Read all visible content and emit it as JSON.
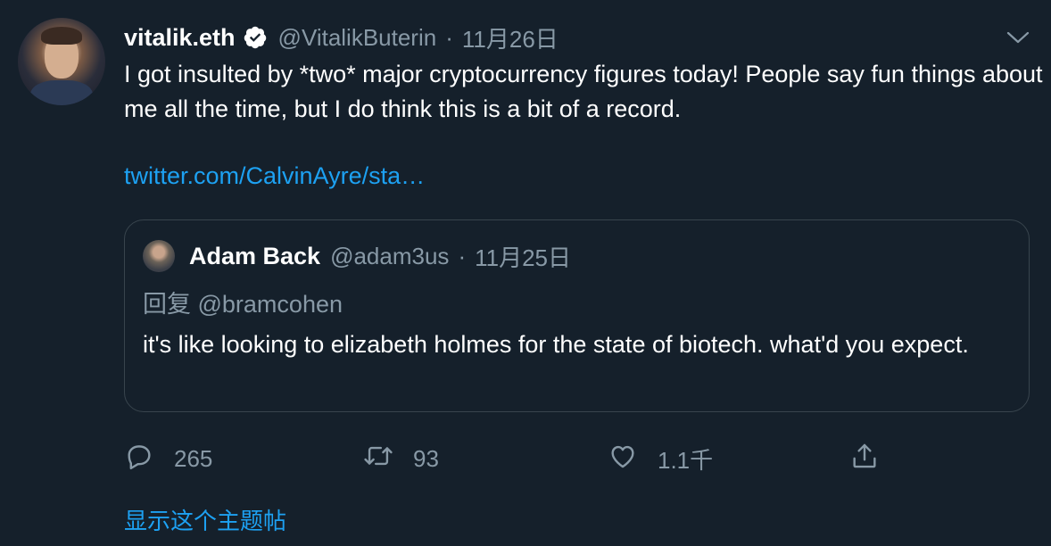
{
  "tweet": {
    "author_name": "vitalik.eth",
    "handle": "@VitalikButerin",
    "date": "11月26日",
    "text": "I got insulted by *two* major cryptocurrency figures today! People say fun things about me all the time, but I do think this is a bit of a record.",
    "link": "twitter.com/CalvinAyre/sta…"
  },
  "quoted": {
    "author_name": "Adam Back",
    "handle": "@adam3us",
    "date": "11月25日",
    "reply_to": "回复 @bramcohen",
    "text": "it's like looking to elizabeth holmes for the state of biotech. what'd you expect."
  },
  "actions": {
    "replies": "265",
    "retweets": "93",
    "likes": "1.1千"
  },
  "show_thread": "显示这个主题帖",
  "colors": {
    "background": "#15202b",
    "secondary_text": "#8899a6",
    "link": "#1da1f2",
    "border": "#38444d"
  },
  "icons": [
    "verified-badge-icon",
    "chevron-down-icon",
    "reply-icon",
    "retweet-icon",
    "like-icon",
    "share-icon"
  ]
}
